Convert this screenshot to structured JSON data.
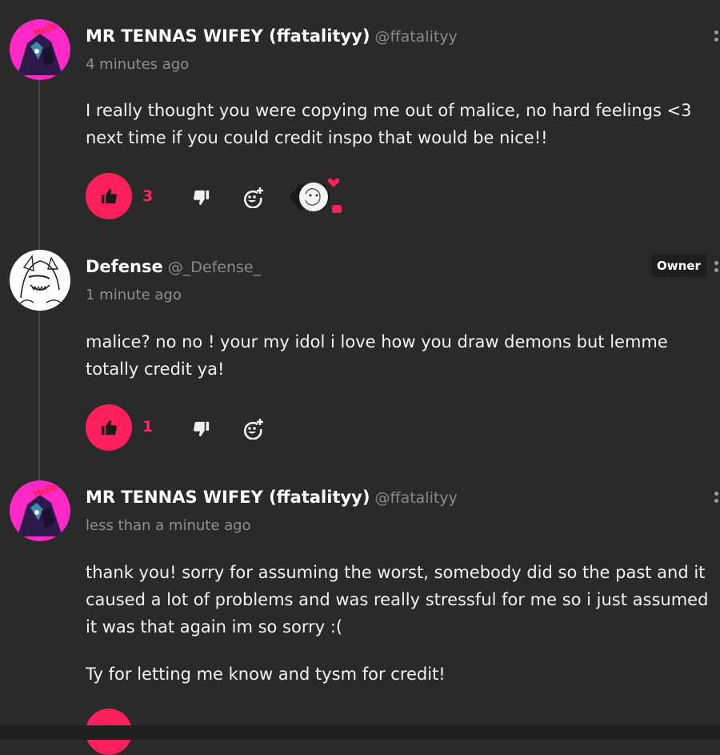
{
  "comments": [
    {
      "author": "MR TENNAS WIFEY (ffatalityy)",
      "handle": "@ffatalityy",
      "time": "4 minutes ago",
      "lines": [
        "I really thought you were copying me out of malice, no hard feelings <3",
        "next time if you could credit inspo that would be nice!!"
      ],
      "likes": "3",
      "avatar_text": "Hello Bro",
      "avatar_mark": "!!"
    },
    {
      "author": "Defense",
      "handle": "@_Defense_",
      "badge": "Owner",
      "time": "1 minute ago",
      "lines": [
        "malice? no no ! your my idol i love how you draw demons but lemme",
        "totally credit ya!"
      ],
      "likes": "1"
    },
    {
      "author": "MR TENNAS WIFEY (ffatalityy)",
      "handle": "@ffatalityy",
      "time": "less than a minute ago",
      "lines": [
        "thank you! sorry for assuming the worst, somebody did so the past and it",
        "caused a lot of problems and was really stressful for me so i just assumed",
        "it was that again im so sorry :(",
        "",
        "Ty for letting me know and tysm for credit!"
      ],
      "avatar_text": "Hello Bro",
      "avatar_mark": "!!"
    }
  ],
  "colors": {
    "background": "#2a2a2b",
    "accent": "#ff1f5a",
    "muted_text": "#8f8f93"
  },
  "icons": {
    "like": "thumbs-up-icon",
    "dislike": "thumbs-down-icon",
    "reaction": "add-reaction-icon",
    "menu": "more-vertical-icon"
  }
}
